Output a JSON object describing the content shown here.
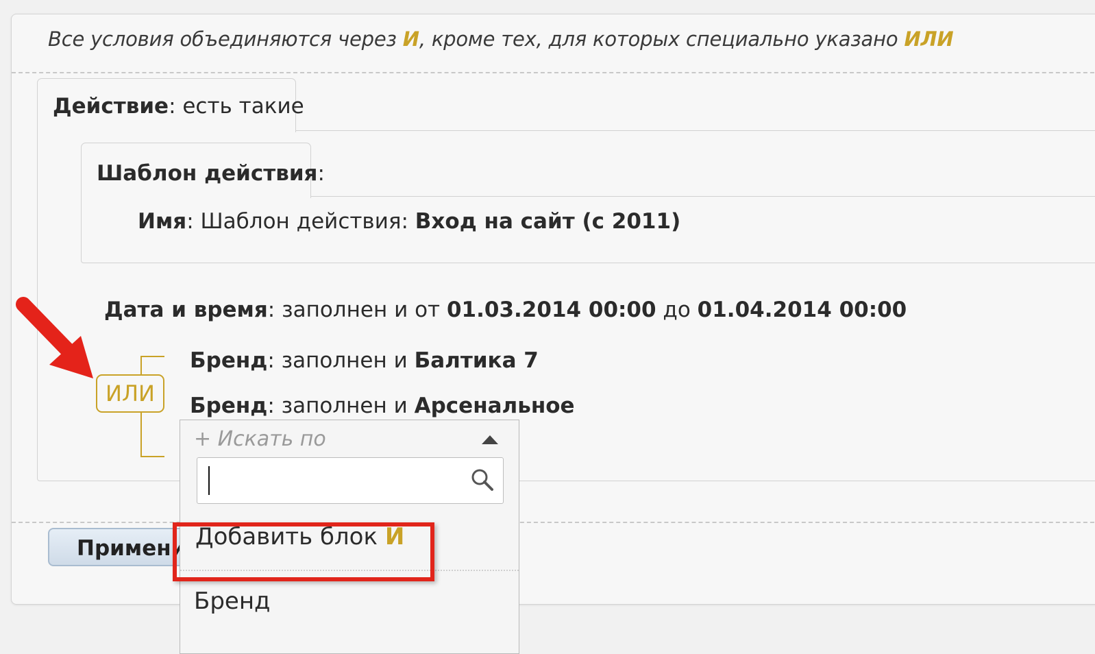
{
  "hint": {
    "prefix": "Все условия объединяются через ",
    "and_word": "И",
    "middle": ", кроме тех, для которых специально указано ",
    "or_word": "ИЛИ"
  },
  "action_tab": {
    "label": "Действие",
    "value": ": есть такие"
  },
  "template_tab": {
    "label": "Шаблон действия",
    "suffix": ":"
  },
  "name_line": {
    "label": "Имя",
    "prefix": ": Шаблон действия: ",
    "value": "Вход на сайт (с 2011)"
  },
  "datetime_line": {
    "label": "Дата и время",
    "text1": ": заполнен и от ",
    "from": "01.03.2014 00:00",
    "text2": " до ",
    "to": "01.04.2014 00:00"
  },
  "brands": [
    {
      "label": "Бренд",
      "text": ": заполнен и ",
      "value": "Балтика 7"
    },
    {
      "label": "Бренд",
      "text": ": заполнен и ",
      "value": "Арсенальное"
    }
  ],
  "or_badge": "ИЛИ",
  "dropdown": {
    "header": "+ Искать по",
    "search_value": "",
    "items": [
      {
        "text": "Добавить блок ",
        "accent": "И"
      },
      {
        "text": "Бренд"
      }
    ]
  },
  "apply_button": "Применить",
  "colors": {
    "accent": "#c9a227",
    "highlight": "#e1251b"
  }
}
